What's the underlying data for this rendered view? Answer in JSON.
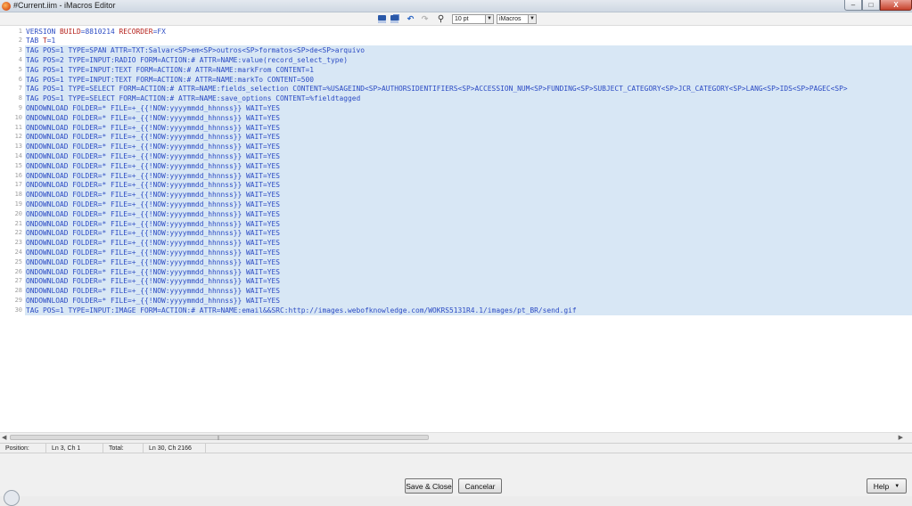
{
  "window": {
    "title": "#Current.iim - iMacros Editor",
    "controls": {
      "minimize": "–",
      "maximize": "□",
      "close": "X"
    }
  },
  "toolbar": {
    "icons": [
      "save-icon",
      "save-as-icon",
      "undo-icon",
      "redo-icon",
      "find-icon"
    ],
    "font_size": "10 pt",
    "language": "iMacros"
  },
  "editor": {
    "lines": [
      {
        "n": "1",
        "text": "VERSION BUILD=8810214 RECORDER=FX",
        "selected": false
      },
      {
        "n": "2",
        "text": "TAB T=1",
        "selected": false
      },
      {
        "n": "3",
        "text": "TAG POS=1 TYPE=SPAN ATTR=TXT:Salvar<SP>em<SP>outros<SP>formatos<SP>de<SP>arquivo",
        "selected": true
      },
      {
        "n": "4",
        "text": "TAG POS=2 TYPE=INPUT:RADIO FORM=ACTION:# ATTR=NAME:value(record_select_type)",
        "selected": true
      },
      {
        "n": "5",
        "text": "TAG POS=1 TYPE=INPUT:TEXT FORM=ACTION:# ATTR=NAME:markFrom CONTENT=1",
        "selected": true
      },
      {
        "n": "6",
        "text": "TAG POS=1 TYPE=INPUT:TEXT FORM=ACTION:# ATTR=NAME:markTo CONTENT=500",
        "selected": true
      },
      {
        "n": "7",
        "text": "TAG POS=1 TYPE=SELECT FORM=ACTION:# ATTR=NAME:fields_selection CONTENT=%USAGEIND<SP>AUTHORSIDENTIFIERS<SP>ACCESSION_NUM<SP>FUNDING<SP>SUBJECT_CATEGORY<SP>JCR_CATEGORY<SP>LANG<SP>IDS<SP>PAGEC<SP>",
        "selected": true
      },
      {
        "n": "8",
        "text": "TAG POS=1 TYPE=SELECT FORM=ACTION:# ATTR=NAME:save_options CONTENT=%fieldtagged",
        "selected": true
      },
      {
        "n": "9",
        "text": "ONDOWNLOAD FOLDER=* FILE=+_{{!NOW:yyyymmdd_hhnnss}} WAIT=YES",
        "selected": true
      },
      {
        "n": "10",
        "text": "ONDOWNLOAD FOLDER=* FILE=+_{{!NOW:yyyymmdd_hhnnss}} WAIT=YES",
        "selected": true
      },
      {
        "n": "11",
        "text": "ONDOWNLOAD FOLDER=* FILE=+_{{!NOW:yyyymmdd_hhnnss}} WAIT=YES",
        "selected": true
      },
      {
        "n": "12",
        "text": "ONDOWNLOAD FOLDER=* FILE=+_{{!NOW:yyyymmdd_hhnnss}} WAIT=YES",
        "selected": true
      },
      {
        "n": "13",
        "text": "ONDOWNLOAD FOLDER=* FILE=+_{{!NOW:yyyymmdd_hhnnss}} WAIT=YES",
        "selected": true
      },
      {
        "n": "14",
        "text": "ONDOWNLOAD FOLDER=* FILE=+_{{!NOW:yyyymmdd_hhnnss}} WAIT=YES",
        "selected": true
      },
      {
        "n": "15",
        "text": "ONDOWNLOAD FOLDER=* FILE=+_{{!NOW:yyyymmdd_hhnnss}} WAIT=YES",
        "selected": true
      },
      {
        "n": "16",
        "text": "ONDOWNLOAD FOLDER=* FILE=+_{{!NOW:yyyymmdd_hhnnss}} WAIT=YES",
        "selected": true
      },
      {
        "n": "17",
        "text": "ONDOWNLOAD FOLDER=* FILE=+_{{!NOW:yyyymmdd_hhnnss}} WAIT=YES",
        "selected": true
      },
      {
        "n": "18",
        "text": "ONDOWNLOAD FOLDER=* FILE=+_{{!NOW:yyyymmdd_hhnnss}} WAIT=YES",
        "selected": true
      },
      {
        "n": "19",
        "text": "ONDOWNLOAD FOLDER=* FILE=+_{{!NOW:yyyymmdd_hhnnss}} WAIT=YES",
        "selected": true
      },
      {
        "n": "20",
        "text": "ONDOWNLOAD FOLDER=* FILE=+_{{!NOW:yyyymmdd_hhnnss}} WAIT=YES",
        "selected": true
      },
      {
        "n": "21",
        "text": "ONDOWNLOAD FOLDER=* FILE=+_{{!NOW:yyyymmdd_hhnnss}} WAIT=YES",
        "selected": true
      },
      {
        "n": "22",
        "text": "ONDOWNLOAD FOLDER=* FILE=+_{{!NOW:yyyymmdd_hhnnss}} WAIT=YES",
        "selected": true
      },
      {
        "n": "23",
        "text": "ONDOWNLOAD FOLDER=* FILE=+_{{!NOW:yyyymmdd_hhnnss}} WAIT=YES",
        "selected": true
      },
      {
        "n": "24",
        "text": "ONDOWNLOAD FOLDER=* FILE=+_{{!NOW:yyyymmdd_hhnnss}} WAIT=YES",
        "selected": true
      },
      {
        "n": "25",
        "text": "ONDOWNLOAD FOLDER=* FILE=+_{{!NOW:yyyymmdd_hhnnss}} WAIT=YES",
        "selected": true
      },
      {
        "n": "26",
        "text": "ONDOWNLOAD FOLDER=* FILE=+_{{!NOW:yyyymmdd_hhnnss}} WAIT=YES",
        "selected": true
      },
      {
        "n": "27",
        "text": "ONDOWNLOAD FOLDER=* FILE=+_{{!NOW:yyyymmdd_hhnnss}} WAIT=YES",
        "selected": true
      },
      {
        "n": "28",
        "text": "ONDOWNLOAD FOLDER=* FILE=+_{{!NOW:yyyymmdd_hhnnss}} WAIT=YES",
        "selected": true
      },
      {
        "n": "29",
        "text": "ONDOWNLOAD FOLDER=* FILE=+_{{!NOW:yyyymmdd_hhnnss}} WAIT=YES",
        "selected": true
      },
      {
        "n": "30",
        "text": "TAG POS=1 TYPE=INPUT:IMAGE FORM=ACTION:# ATTR=NAME:email&&SRC:http://images.webofknowledge.com/WOKRS5131R4.1/images/pt_BR/send.gif",
        "selected": true
      }
    ]
  },
  "statusbar": {
    "position_label": "Position:",
    "position_value": "Ln 3, Ch 1",
    "total_label": "Total:",
    "total_value": "Ln 30, Ch 2166"
  },
  "buttons": {
    "save_close": "Save & Close",
    "cancel": "Cancelar",
    "help": "Help"
  },
  "colors": {
    "code_text": "#2c4cc4",
    "keyword_red": "#b5211b",
    "selection_bg": "#d8e7f5",
    "line_number": "#a0a0a0"
  }
}
